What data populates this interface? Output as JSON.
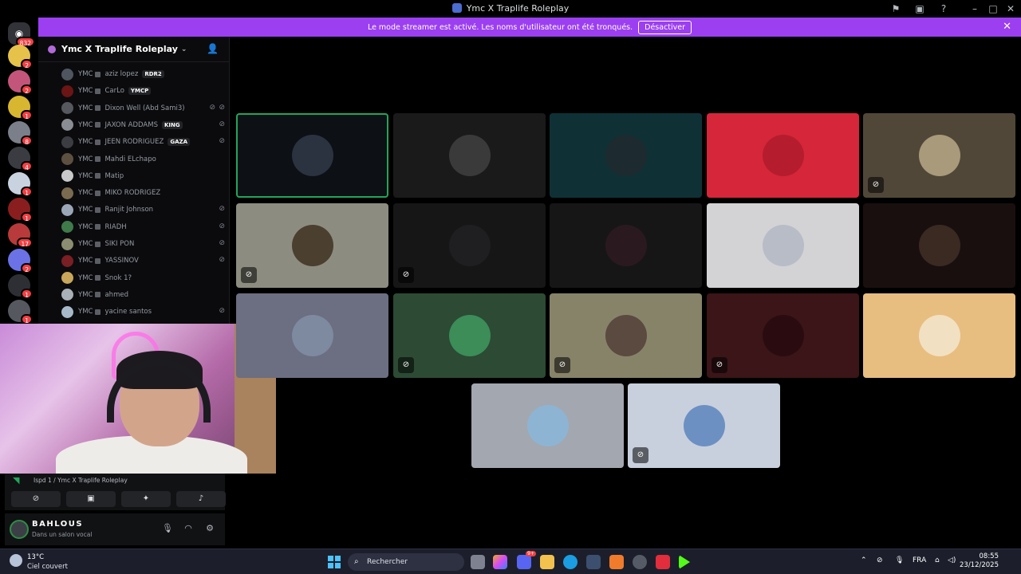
{
  "window": {
    "title": "Ymc X Traplife Roleplay"
  },
  "banner": {
    "message": "Le mode streamer est activé. Les noms d'utilisateur ont été tronqués.",
    "disable_label": "Désactiver"
  },
  "rail": {
    "dm_badge": "832",
    "servers": [
      {
        "badge": "2",
        "color": "#e6c24a"
      },
      {
        "badge": "2",
        "color": "#c4557a"
      },
      {
        "badge": "1",
        "color": "#d8b730"
      },
      {
        "badge": "8",
        "color": "#7a7f8a"
      },
      {
        "badge": "4",
        "color": "#3a3c42"
      },
      {
        "badge": "1",
        "color": "#c9d3e0"
      },
      {
        "badge": "1",
        "color": "#8a1e1e"
      },
      {
        "badge": "17",
        "color": "#b93a3a"
      },
      {
        "badge": "2",
        "color": "#6a72e6"
      },
      {
        "badge": "1",
        "color": "#2d2f35"
      },
      {
        "badge": "1",
        "color": "#55585f"
      }
    ]
  },
  "server": {
    "name": "Ymc X Traplife Roleplay"
  },
  "members": [
    {
      "tag": "YMC",
      "name": "aziz lopez",
      "badge": "RDR2",
      "muted": false,
      "deaf": false,
      "color": "#4f5660"
    },
    {
      "tag": "YMC",
      "name": "CarLo",
      "badge": "YMCP",
      "muted": false,
      "deaf": false,
      "color": "#6b1515"
    },
    {
      "tag": "YMC",
      "name": "Dixon Well (Abd Sami3)",
      "badge": "",
      "muted": true,
      "deaf": true,
      "color": "#55585f"
    },
    {
      "tag": "YMC",
      "name": "JAXON ADDAMS",
      "badge": "KING",
      "muted": true,
      "deaf": false,
      "color": "#8a8d93"
    },
    {
      "tag": "YMC",
      "name": "JEEN RODRIGUEZ",
      "badge": "GAZA",
      "muted": true,
      "deaf": false,
      "color": "#3b3d42"
    },
    {
      "tag": "YMC",
      "name": "Mahdi ELchapo",
      "badge": "",
      "muted": false,
      "deaf": false,
      "color": "#5e5040"
    },
    {
      "tag": "YMC",
      "name": "Matip",
      "badge": "",
      "muted": false,
      "deaf": false,
      "color": "#c9c9c9"
    },
    {
      "tag": "YMC",
      "name": "MIKO RODRIGEZ",
      "badge": "",
      "muted": false,
      "deaf": false,
      "color": "#7a6a50"
    },
    {
      "tag": "YMC",
      "name": "Ranjit Johnson",
      "badge": "",
      "muted": true,
      "deaf": false,
      "color": "#9aa6b8"
    },
    {
      "tag": "YMC",
      "name": "RIADH",
      "badge": "",
      "muted": true,
      "deaf": false,
      "color": "#3f7a4a"
    },
    {
      "tag": "YMC",
      "name": "SIKI PON",
      "badge": "",
      "muted": true,
      "deaf": false,
      "color": "#8a8d70"
    },
    {
      "tag": "YMC",
      "name": "YASSINOV",
      "badge": "",
      "muted": true,
      "deaf": false,
      "color": "#7a1f24"
    },
    {
      "tag": "YMC",
      "name": "Snok 1?",
      "badge": "",
      "muted": false,
      "deaf": false,
      "color": "#c9a75a"
    },
    {
      "tag": "YMC",
      "name": "ahmed",
      "badge": "",
      "muted": false,
      "deaf": false,
      "color": "#aab0b8"
    },
    {
      "tag": "YMC",
      "name": "yacine santos",
      "badge": "",
      "muted": true,
      "deaf": false,
      "color": "#a7b8c9"
    }
  ],
  "voice": {
    "channel_path": "Ispd 1 / Ymc X Traplife Roleplay",
    "buttons": [
      "camera-off",
      "screen-share",
      "activities",
      "soundboard"
    ]
  },
  "user": {
    "name": "BAHLOUS",
    "status": "Dans un salon vocal"
  },
  "tiles": [
    {
      "bg": "#0d1014",
      "av": "#2b3240",
      "speaking": true,
      "muted": false
    },
    {
      "bg": "#1a1a1a",
      "av": "#3a3a3a",
      "speaking": false,
      "muted": false
    },
    {
      "bg": "#0f3136",
      "av": "#1d2a30",
      "speaking": false,
      "muted": false
    },
    {
      "bg": "#d6263a",
      "av": "#b51d2e",
      "speaking": false,
      "muted": false
    },
    {
      "bg": "#504738",
      "av": "#a89a7a",
      "speaking": false,
      "muted": true
    },
    {
      "bg": "#8c8d80",
      "av": "#4b3f30",
      "speaking": false,
      "muted": true
    },
    {
      "bg": "#161616",
      "av": "#1f1f22",
      "speaking": false,
      "muted": true
    },
    {
      "bg": "#161616",
      "av": "#2a1a20",
      "speaking": false,
      "muted": false
    },
    {
      "bg": "#d3d3d6",
      "av": "#b8bcc6",
      "speaking": false,
      "muted": false
    },
    {
      "bg": "#1a0f0f",
      "av": "#3a2a22",
      "speaking": false,
      "muted": false
    },
    {
      "bg": "#6c6e82",
      "av": "#7d8aa0",
      "speaking": false,
      "muted": false
    },
    {
      "bg": "#2c4a34",
      "av": "#3c8d58",
      "speaking": false,
      "muted": true
    },
    {
      "bg": "#878368",
      "av": "#5a4a40",
      "speaking": false,
      "muted": true
    },
    {
      "bg": "#3b1518",
      "av": "#2a0c10",
      "speaking": false,
      "muted": true
    },
    {
      "bg": "#e8bd80",
      "av": "#f2e0c2",
      "speaking": false,
      "muted": false
    },
    {
      "bg": "#a3a7af",
      "av": "#8eb4d4",
      "speaking": false,
      "muted": false
    },
    {
      "bg": "#c8d0de",
      "av": "#6d90c2",
      "speaking": false,
      "muted": true
    }
  ],
  "taskbar": {
    "temperature": "13°C",
    "weather": "Ciel couvert",
    "search_placeholder": "Rechercher",
    "language": "FRA",
    "time": "08:55",
    "date": "23/12/2025",
    "discord_badge": "9+"
  }
}
